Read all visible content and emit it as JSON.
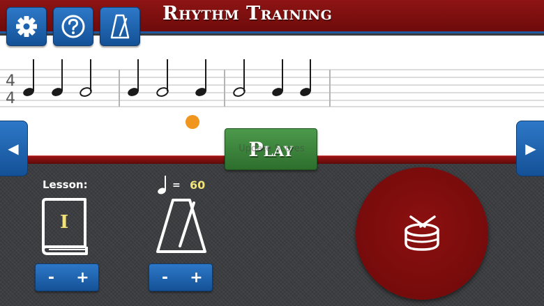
{
  "header": {
    "title": "Rhythm Training"
  },
  "toolbar": {
    "settings_icon": "gear-icon",
    "help_icon": "help-circle-icon",
    "metronome_icon": "metronome-icon"
  },
  "staff": {
    "time_signature_top": "4",
    "time_signature_bottom": "4"
  },
  "controls": {
    "play_label": "Play",
    "play_overlay_text": "Update Scores",
    "prev_arrow": "◀",
    "next_arrow": "▶"
  },
  "lesson": {
    "label": "Lesson:",
    "number": "I",
    "minus": "-",
    "plus": "+"
  },
  "tempo": {
    "equals": "=",
    "bpm": "60",
    "minus": "-",
    "plus": "+"
  },
  "colors": {
    "header_red": "#8e1414",
    "button_blue": "#1f64b0",
    "play_green": "#3f8a3f",
    "drum_red": "#7a0c0c",
    "beat_dot": "#f0951e",
    "accent_yellow": "#f1e27a"
  }
}
